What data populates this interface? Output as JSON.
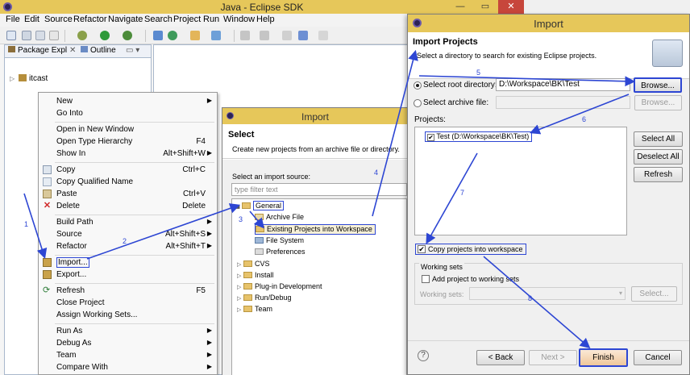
{
  "eclipse": {
    "title": "Java - Eclipse SDK",
    "menu": [
      "File",
      "Edit",
      "Source",
      "Refactor",
      "Navigate",
      "Search",
      "Project",
      "Run",
      "Window",
      "Help"
    ],
    "views": {
      "package_tab": "Package Expl",
      "outline_tab": "Outline"
    },
    "project_name": "itcast"
  },
  "context_menu": {
    "items": [
      {
        "label": "New",
        "shortcut": "",
        "submenu": true
      },
      {
        "label": "Go Into",
        "shortcut": "",
        "submenu": false
      },
      {
        "label": "Open in New Window",
        "shortcut": "",
        "submenu": false
      },
      {
        "label": "Open Type Hierarchy",
        "shortcut": "F4",
        "submenu": false
      },
      {
        "label": "Show In",
        "shortcut": "Alt+Shift+W",
        "submenu": true
      },
      {
        "label": "Copy",
        "shortcut": "Ctrl+C",
        "submenu": false
      },
      {
        "label": "Copy Qualified Name",
        "shortcut": "",
        "submenu": false
      },
      {
        "label": "Paste",
        "shortcut": "Ctrl+V",
        "submenu": false
      },
      {
        "label": "Delete",
        "shortcut": "Delete",
        "submenu": false
      },
      {
        "label": "Build Path",
        "shortcut": "",
        "submenu": true
      },
      {
        "label": "Source",
        "shortcut": "Alt+Shift+S",
        "submenu": true
      },
      {
        "label": "Refactor",
        "shortcut": "Alt+Shift+T",
        "submenu": true
      },
      {
        "label": "Import...",
        "shortcut": "",
        "submenu": false
      },
      {
        "label": "Export...",
        "shortcut": "",
        "submenu": false
      },
      {
        "label": "Refresh",
        "shortcut": "F5",
        "submenu": false
      },
      {
        "label": "Close Project",
        "shortcut": "",
        "submenu": false
      },
      {
        "label": "Assign Working Sets...",
        "shortcut": "",
        "submenu": false
      },
      {
        "label": "Run As",
        "shortcut": "",
        "submenu": true
      },
      {
        "label": "Debug As",
        "shortcut": "",
        "submenu": true
      },
      {
        "label": "Team",
        "shortcut": "",
        "submenu": true
      },
      {
        "label": "Compare With",
        "shortcut": "",
        "submenu": true
      }
    ]
  },
  "import_dialog_1": {
    "title": "Import",
    "heading": "Select",
    "description": "Create new projects from an archive file or directory.",
    "source_label": "Select an import source:",
    "filter_placeholder": "type filter text",
    "tree": {
      "general": "General",
      "general_children": [
        "Archive File",
        "Existing Projects into Workspace",
        "File System",
        "Preferences"
      ],
      "others": [
        "CVS",
        "Install",
        "Plug-in Development",
        "Run/Debug",
        "Team"
      ]
    }
  },
  "import_dialog_2": {
    "title": "Import",
    "heading": "Import Projects",
    "description": "Select a directory to search for existing Eclipse projects.",
    "root_dir_label": "Select root directory:",
    "root_dir_value": "D:\\Workspace\\BK\\Test",
    "archive_label": "Select archive file:",
    "browse": "Browse...",
    "projects_label": "Projects:",
    "project_item": "Test (D:\\Workspace\\BK\\Test)",
    "select_all": "Select All",
    "deselect_all": "Deselect All",
    "refresh": "Refresh",
    "copy_label": "Copy projects into workspace",
    "working_sets_group": "Working sets",
    "add_to_ws": "Add project to working sets",
    "ws_label": "Working sets:",
    "select_btn": "Select...",
    "help": "?",
    "back": "< Back",
    "next": "Next >",
    "finish": "Finish",
    "cancel": "Cancel"
  },
  "annotations": [
    "1",
    "2",
    "3",
    "4",
    "5",
    "6",
    "7",
    "8"
  ],
  "colors": {
    "titlebar": "#e6c75a",
    "annotation": "#2d46d3",
    "close": "#c7463b"
  }
}
